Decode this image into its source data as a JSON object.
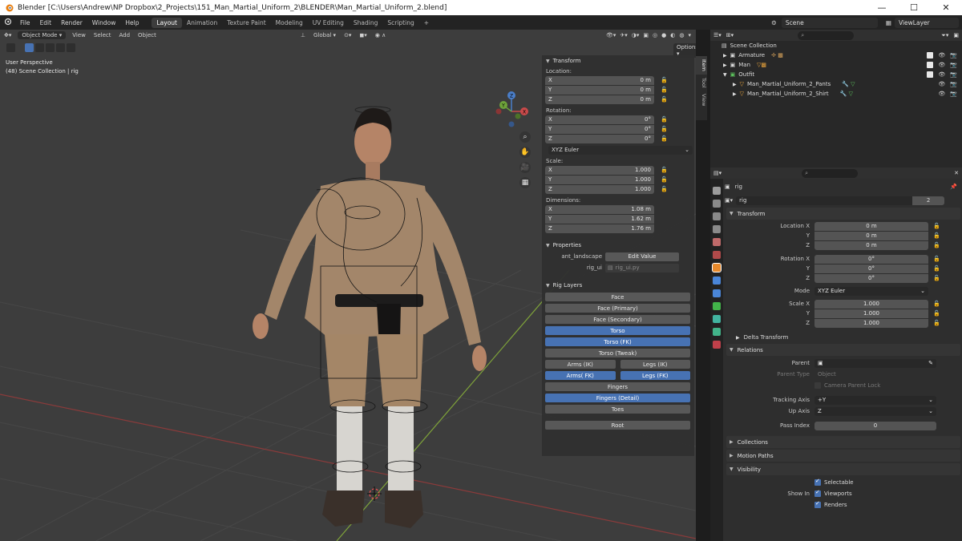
{
  "titlebar": {
    "title": "Blender [C:\\Users\\Andrew\\NP Dropbox\\2_Projects\\151_Man_Martial_Uniform_2\\BLENDER\\Man_Martial_Uniform_2.blend]",
    "minimize": "—",
    "maximize": "☐",
    "close": "✕"
  },
  "menubar": {
    "menus": [
      "File",
      "Edit",
      "Render",
      "Window",
      "Help"
    ],
    "tabs": [
      "Layout",
      "Animation",
      "Texture Paint",
      "Modeling",
      "UV Editing",
      "Shading",
      "Scripting"
    ],
    "active_tab": "Layout",
    "add_tab": "+",
    "scene": "Scene",
    "view_layer": "ViewLayer"
  },
  "viewport": {
    "mode": "Object Mode",
    "menus": [
      "View",
      "Select",
      "Add",
      "Object"
    ],
    "transform_orientation": "Global",
    "options": "Options",
    "info_line1": "User Perspective",
    "info_line2": "(48) Scene Collection | rig",
    "gizmo": {
      "x": "X",
      "y": "Y",
      "z": "Z"
    }
  },
  "side_tabs": [
    "Item",
    "Tool",
    "View"
  ],
  "npanel": {
    "transform_title": "Transform",
    "location_label": "Location:",
    "location": [
      {
        "axis": "X",
        "value": "0 m"
      },
      {
        "axis": "Y",
        "value": "0 m"
      },
      {
        "axis": "Z",
        "value": "0 m"
      }
    ],
    "rotation_label": "Rotation:",
    "rotation": [
      {
        "axis": "X",
        "value": "0°"
      },
      {
        "axis": "Y",
        "value": "0°"
      },
      {
        "axis": "Z",
        "value": "0°"
      }
    ],
    "rotation_mode": "XYZ Euler",
    "scale_label": "Scale:",
    "scale": [
      {
        "axis": "X",
        "value": "1.000"
      },
      {
        "axis": "Y",
        "value": "1.000"
      },
      {
        "axis": "Z",
        "value": "1.000"
      }
    ],
    "dimensions_label": "Dimensions:",
    "dimensions": [
      {
        "axis": "X",
        "value": "1.08 m"
      },
      {
        "axis": "Y",
        "value": "1.62 m"
      },
      {
        "axis": "Z",
        "value": "1.76 m"
      }
    ],
    "properties_title": "Properties",
    "prop_ant_label": "ant_landscape",
    "prop_ant_button": "Edit Value",
    "prop_rig_label": "rig_ui",
    "prop_rig_value": "rig_ui.py",
    "rig_layers_title": "Rig Layers",
    "layers": {
      "face": "Face",
      "face_primary": "Face (Primary)",
      "face_secondary": "Face (Secondary)",
      "torso": "Torso",
      "torso_fk": "Torso (FK)",
      "torso_tweak": "Torso (Tweak)",
      "arms_ik": "Arms (IK)",
      "legs_ik": "Legs (IK)",
      "arms_fk": "Arms( FK)",
      "legs_fk": "Legs (FK)",
      "fingers": "Fingers",
      "fingers_detail": "Fingers (Detail)",
      "toes": "Toes",
      "root": "Root"
    }
  },
  "outliner": {
    "search_placeholder": "",
    "root": "Scene Collection",
    "items": [
      {
        "name": "Armature",
        "indent": 1
      },
      {
        "name": "Man",
        "indent": 1
      },
      {
        "name": "Outfit",
        "indent": 1
      },
      {
        "name": "Man_Martial_Uniform_2_Pants",
        "indent": 2
      },
      {
        "name": "Man_Martial_Uniform_2_Shirt",
        "indent": 2
      }
    ]
  },
  "properties": {
    "object_name": "rig",
    "data_name": "rig",
    "users": "2",
    "transform_title": "Transform",
    "location": [
      {
        "label": "Location X",
        "value": "0 m"
      },
      {
        "label": "Y",
        "value": "0 m"
      },
      {
        "label": "Z",
        "value": "0 m"
      }
    ],
    "rotation": [
      {
        "label": "Rotation X",
        "value": "0°"
      },
      {
        "label": "Y",
        "value": "0°"
      },
      {
        "label": "Z",
        "value": "0°"
      }
    ],
    "mode_label": "Mode",
    "mode_value": "XYZ Euler",
    "scale": [
      {
        "label": "Scale X",
        "value": "1.000"
      },
      {
        "label": "Y",
        "value": "1.000"
      },
      {
        "label": "Z",
        "value": "1.000"
      }
    ],
    "delta_transform": "Delta Transform",
    "relations_title": "Relations",
    "parent_label": "Parent",
    "parent_type_label": "Parent Type",
    "parent_type_value": "Object",
    "camera_parent_lock": "Camera Parent Lock",
    "tracking_axis_label": "Tracking Axis",
    "tracking_axis_value": "+Y",
    "up_axis_label": "Up Axis",
    "up_axis_value": "Z",
    "pass_index_label": "Pass Index",
    "pass_index_value": "0",
    "collections_title": "Collections",
    "motion_paths_title": "Motion Paths",
    "visibility_title": "Visibility",
    "selectable": "Selectable",
    "show_in_label": "Show In",
    "viewports": "Viewports",
    "renders": "Renders"
  },
  "colors": {
    "accent": "#4772b3",
    "viewport_bg": "#3d3d3d",
    "panel_bg": "#2e2e2e"
  }
}
